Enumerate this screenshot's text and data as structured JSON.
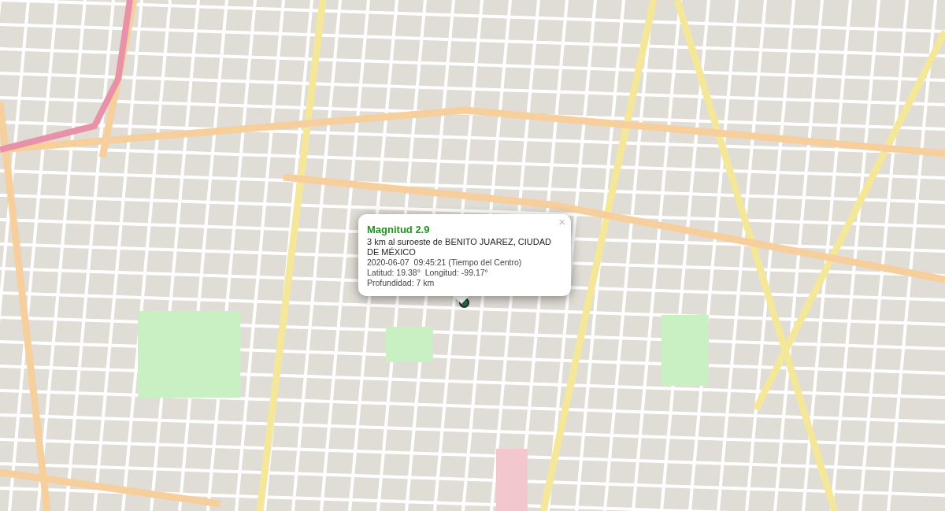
{
  "popup": {
    "close": "×",
    "title": "Magnitud 2.9",
    "location": "3 km al suroeste de BENITO JUAREZ, CIUDAD DE MÉXICO",
    "time": "2020-06-07  09:45:21 (Tiempo del Centro)",
    "coordinates": "Latitud: 19.38°  Longitud: -99.17°",
    "depth": "Profundidad: 7 km"
  }
}
